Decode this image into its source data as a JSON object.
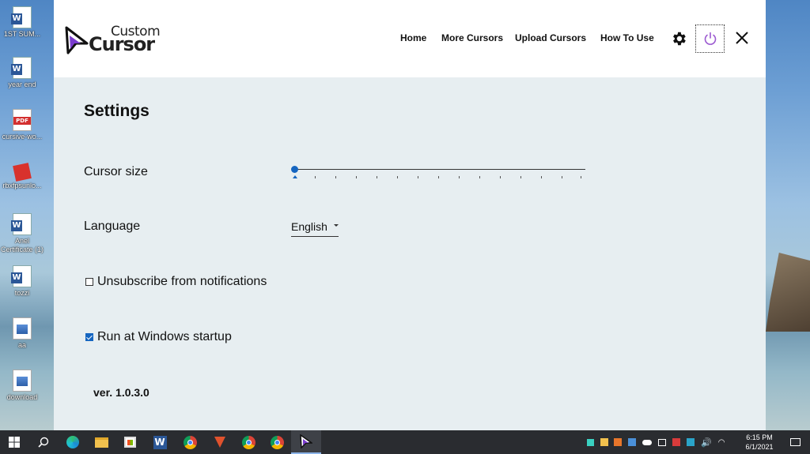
{
  "desktop": {
    "icons": [
      {
        "label": "1ST SUM...",
        "type": "word"
      },
      {
        "label": "year end",
        "type": "word"
      },
      {
        "label": "cursive-wo...",
        "type": "pdf"
      },
      {
        "label": "rbxfpsunlo...",
        "type": "roblox"
      },
      {
        "label": "Anel Certificate (1)",
        "type": "word"
      },
      {
        "label": "tozzi",
        "type": "word"
      },
      {
        "label": "aa",
        "type": "image"
      },
      {
        "label": "download",
        "type": "image"
      }
    ]
  },
  "app": {
    "logo": {
      "top": "Custom",
      "bottom": "Cursor"
    },
    "nav": {
      "home": "Home",
      "more_cursors": "More Cursors",
      "upload_cursors": "Upload Cursors",
      "how_to_use": "How To Use"
    },
    "icons": {
      "settings": "gear-icon",
      "power": "power-icon",
      "close": "close-icon"
    },
    "accent_color": "#1565c0",
    "power_color": "#9b59d0",
    "settings": {
      "title": "Settings",
      "cursor_size_label": "Cursor size",
      "cursor_size_value": 0,
      "language_label": "Language",
      "language_value": "English",
      "unsubscribe_label": "Unsubscribe from notifications",
      "unsubscribe_checked": false,
      "startup_label": "Run at Windows startup",
      "startup_checked": true,
      "version": "ver. 1.0.3.0"
    }
  },
  "taskbar": {
    "apps": [
      "windows-start-icon",
      "search-icon",
      "edge-icon",
      "file-explorer-icon",
      "store-icon",
      "word-icon",
      "chrome-icon",
      "brave-icon",
      "chrome-icon",
      "chrome-icon",
      "custom-cursor-icon"
    ],
    "time": "6:15 PM",
    "date": "6/1/2021"
  }
}
